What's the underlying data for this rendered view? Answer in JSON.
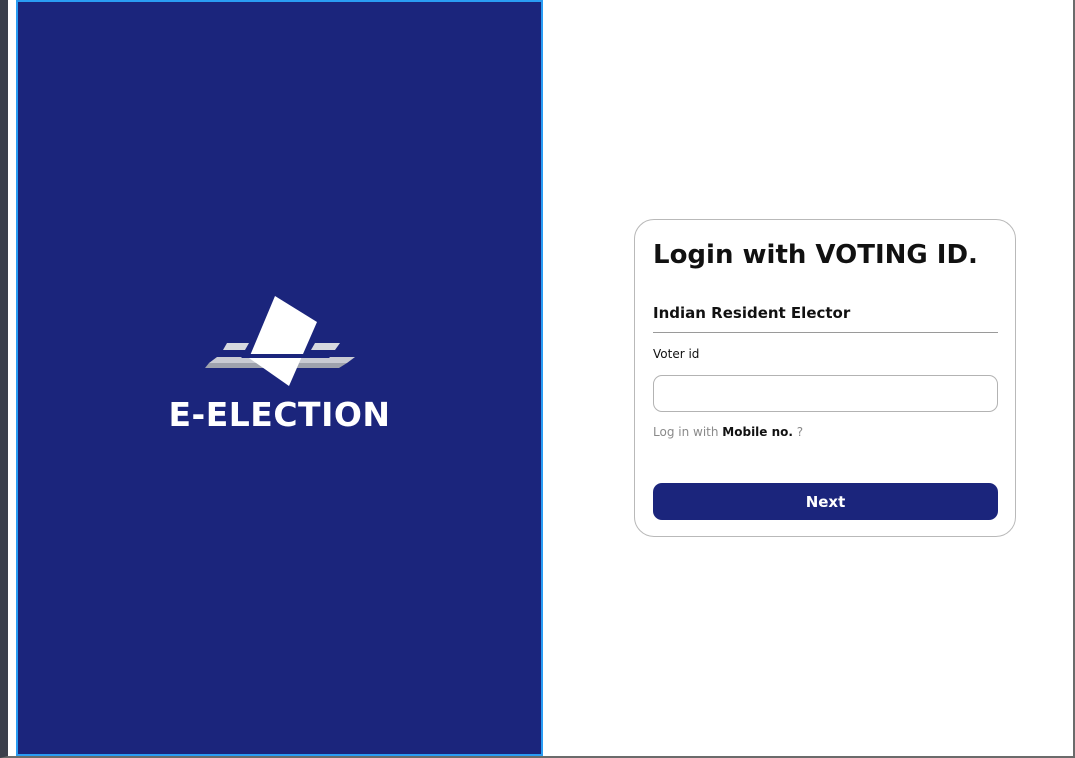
{
  "brand": {
    "name": "E-ELECTION",
    "logo_icon": "ballot-box-icon"
  },
  "login": {
    "title": "Login with VOTING ID.",
    "section": "Indian Resident Elector",
    "field_label": "Voter id",
    "field_value": "",
    "alt_prefix": "Log in with",
    "alt_link": "Mobile no.",
    "alt_suffix": "?",
    "next_label": "Next"
  },
  "colors": {
    "brand_navy": "#1b257c",
    "panel_border": "#2a9df4",
    "card_border": "#b9b9b9",
    "muted_text": "#8a8a8a"
  }
}
